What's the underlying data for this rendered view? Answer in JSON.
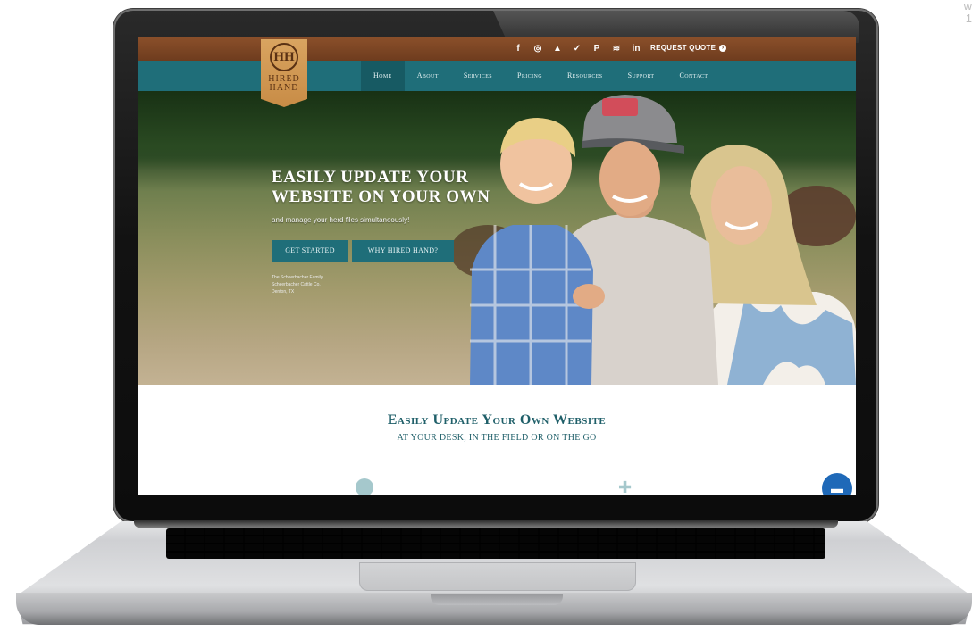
{
  "corner": {
    "line1": "w",
    "line2": "1"
  },
  "header": {
    "social_icons": [
      {
        "name": "facebook-icon",
        "glyph": "f"
      },
      {
        "name": "instagram-icon",
        "glyph": "◎"
      },
      {
        "name": "snapchat-icon",
        "glyph": "▲"
      },
      {
        "name": "twitter-icon",
        "glyph": "✓"
      },
      {
        "name": "pinterest-icon",
        "glyph": "P"
      },
      {
        "name": "rss-icon",
        "glyph": "≋"
      },
      {
        "name": "linkedin-icon",
        "glyph": "in"
      }
    ],
    "request_quote": "REQUEST QUOTE",
    "quote_icon_glyph": "›"
  },
  "logo": {
    "mark": "HH",
    "line1": "HIRED",
    "line2": "HAND"
  },
  "nav": {
    "items": [
      "Home",
      "About",
      "Services",
      "Pricing",
      "Resources",
      "Support",
      "Contact"
    ],
    "active_index": 0
  },
  "hero": {
    "title_line1": "EASILY UPDATE YOUR",
    "title_line2": "WEBSITE ON YOUR OWN",
    "subtitle": "and manage your herd files simultaneously!",
    "button_primary": "GET STARTED",
    "button_secondary": "WHY HIRED HAND?",
    "credit_line1": "The Scheerbacher Family",
    "credit_line2": "Scheerbacher Cattle Co.",
    "credit_line3": "Denton, TX"
  },
  "section": {
    "title": "Easily Update Your Own Website",
    "subtitle": "AT YOUR DESK, IN THE FIELD OR ON THE GO"
  },
  "colors": {
    "teal": "#1f6e79",
    "brown_bar": "#7a4424",
    "logo_gold": "#d29a55",
    "section_text": "#1f5f69",
    "chat_blue": "#1f69b8"
  }
}
